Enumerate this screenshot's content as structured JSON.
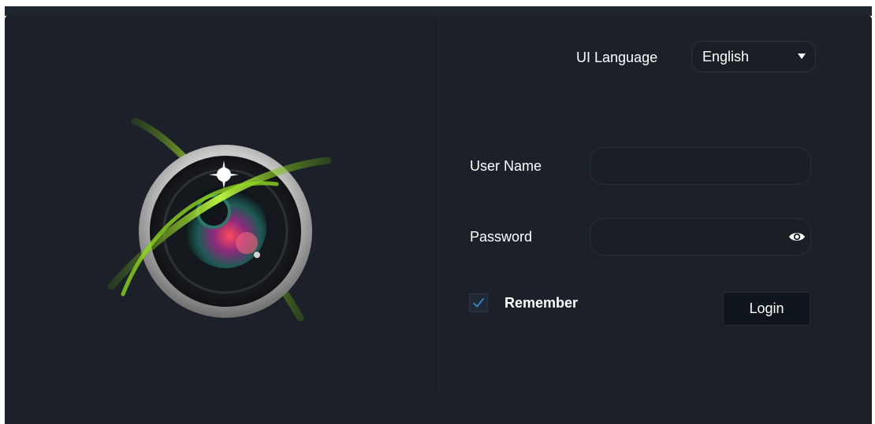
{
  "language": {
    "label": "UI Language",
    "selected": "English",
    "caret_icon": "chevron-down-icon"
  },
  "form": {
    "username_label": "User Name",
    "username_value": "",
    "password_label": "Password",
    "password_value": "",
    "password_toggle_icon": "eye-icon",
    "remember_label": "Remember",
    "remember_checked": true,
    "login_label": "Login"
  },
  "logo_icon": "camera-lens-icon",
  "colors": {
    "background": "#1c2028",
    "accent_green": "#9be020",
    "check_blue": "#3e83c3"
  }
}
